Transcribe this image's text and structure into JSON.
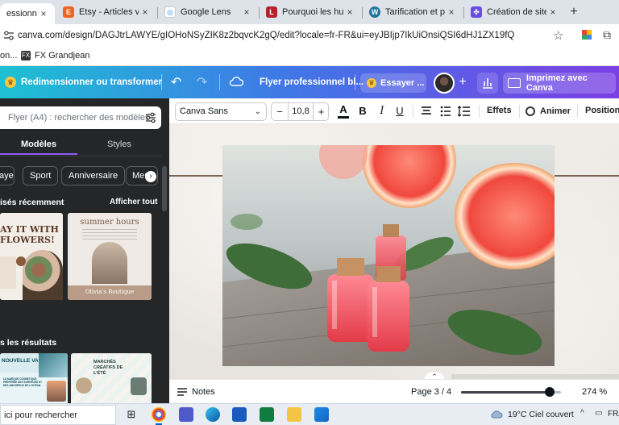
{
  "browser": {
    "tabs": [
      {
        "title": "essionnel bi",
        "favicon": "canva-favicon",
        "color": "#00c4cc",
        "glyph": "C",
        "active": true
      },
      {
        "title": "Etsy - Articles vendus",
        "favicon": "etsy-favicon",
        "color": "#f1641e",
        "glyph": "E",
        "active": false
      },
      {
        "title": "Google Lens",
        "favicon": "google-lens-favicon",
        "color": "#ffffff",
        "glyph": "◎",
        "active": false
      },
      {
        "title": "Pourquoi les huiles e",
        "favicon": "red-l-favicon",
        "color": "#b4232c",
        "glyph": "L",
        "active": false
      },
      {
        "title": "Tarification et plans",
        "favicon": "wordpress-favicon",
        "color": "#21759b",
        "glyph": "W",
        "active": false
      },
      {
        "title": "Création de sites inte",
        "favicon": "site-builder-favicon",
        "color": "#6b4ce6",
        "glyph": "✤",
        "active": false
      }
    ],
    "close_glyph": "×",
    "new_tab_glyph": "+",
    "url": "canva.com/design/DAGJtrLAWYE/gIOHoNSyZIK8z2bqvcK2gQ/edit?locale=fr-FR&ui=eyJBIjp7IkUiOnsiQSI6dHJ1ZX19fQ",
    "bookmarks": [
      "on...",
      "FX Grandjean"
    ]
  },
  "canva_header": {
    "resize_label": "Redimensionner ou transformer",
    "doc_title": "Flyer professionnel bl...",
    "try_label": "Essayer ...",
    "print_label": "Imprimez avec Canva"
  },
  "left_panel": {
    "search_placeholder": "Flyer (A4) : rechercher des modèles",
    "tabs": {
      "models": "Modèles",
      "styles": "Styles"
    },
    "chips": [
      "ayer",
      "Sport",
      "Anniversaire",
      "Mer"
    ],
    "recent_title": "isés récemment",
    "recent_all": "Afficher tout",
    "thumb1_text": "AY IT WITH FLOWERS!",
    "thumb2_title": "summer hours",
    "thumb2_brand": "Olivia's Boutique",
    "results_title": "s les résultats",
    "thumb3_text": "NOUVELLE VAGUE",
    "thumb3_sub": "LA MARQUE COSMETIQUE PRÉFÉRÉE DES SURFEURS ET DES AMOUREUX DE L'OCÉAN",
    "thumb4_text": "MARCHÉS CRÉATIFS DE L'ÉTÉ"
  },
  "toolbar": {
    "font": "Canva Sans",
    "font_size": "10,8",
    "minus": "−",
    "plus": "+",
    "effects": "Effets",
    "animate": "Animer",
    "position": "Position"
  },
  "footer": {
    "notes": "Notes",
    "page": "Page 3 / 4",
    "zoom_value": "274 %",
    "zoom_fraction": 0.89
  },
  "taskbar": {
    "search_text": "ici pour rechercher",
    "weather": "19°C  Ciel couvert",
    "lang": "FRA"
  },
  "colors": {
    "canva_gradient_start": "#1ec1d4",
    "canva_gradient_end": "#7b3fe4",
    "panel_bg": "#252627",
    "active_tab_underline": "#8b5cf6"
  }
}
